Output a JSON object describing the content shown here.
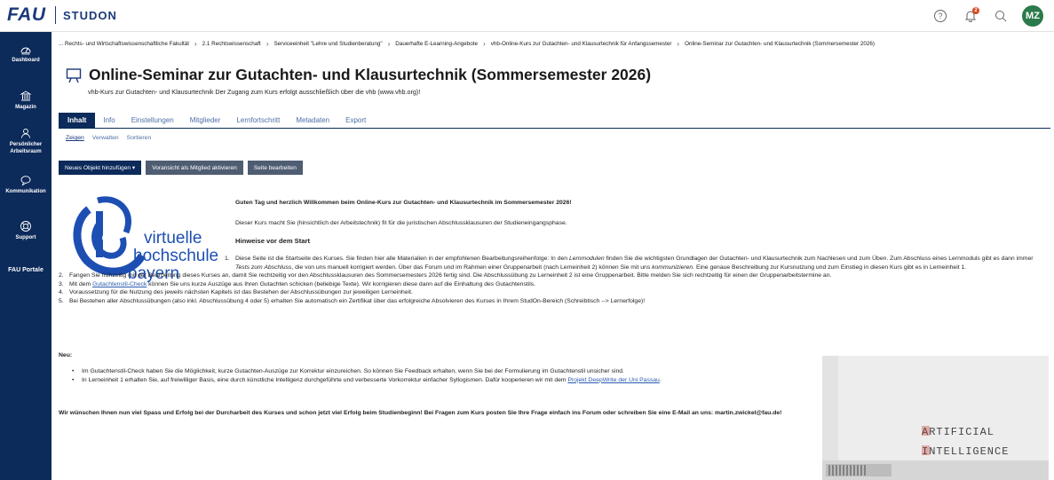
{
  "header": {
    "fau_logo": "FAU",
    "studon_logo": "STUDON",
    "help_icon": "help-circle-icon",
    "notifications_icon": "bell-icon",
    "notifications_count": "2",
    "search_icon": "search-icon",
    "avatar_initials": "MZ"
  },
  "sidebar": {
    "items": [
      {
        "label": "Dashboard",
        "icon": "dashboard-icon"
      },
      {
        "label": "Magazin",
        "icon": "library-icon"
      },
      {
        "label": "Persönlicher Arbeitsraum",
        "icon": "person-icon"
      },
      {
        "label": "Kommunikation",
        "icon": "chat-icon"
      },
      {
        "label": "Support",
        "icon": "lifebuoy-icon"
      },
      {
        "label": "FAU Portale",
        "icon": ""
      }
    ]
  },
  "breadcrumb": [
    "... Rechts- und Wirtschaftswissenschaftliche Fakultät",
    "2.1 Rechtswissenschaft",
    "Serviceeinheit \"Lehre und Studienberatung\"",
    "Dauerhafte E-Learning-Angebote",
    "vhb-Online-Kurs zur Gutachten- und Klausurtechnik für Anfangssemester",
    "Online-Seminar zur Gutachten- und Klausurtechnik (Sommersemester 2026)"
  ],
  "page": {
    "title": "Online-Seminar zur Gutachten- und Klausurtechnik (Sommersemester 2026)",
    "subtitle": "vhb-Kurs zur Gutachten- und Klausurtechnik Der Zugang zum Kurs erfolgt ausschließlich über die vhb (www.vhb.org)!"
  },
  "tabs": [
    "Inhalt",
    "Info",
    "Einstellungen",
    "Mitglieder",
    "Lernfortschritt",
    "Metadaten",
    "Export"
  ],
  "subtabs": [
    "Zeigen",
    "Verwalten",
    "Sortieren"
  ],
  "buttons": {
    "add_object": "Neues Objekt hinzufügen ▾",
    "preview_member": "Voransicht als Mitglied aktivieren",
    "edit_page": "Seite bearbeiten"
  },
  "vhb_logo": {
    "line1": "virtuelle",
    "line2": "hochschule",
    "line3": "bayern"
  },
  "content": {
    "welcome": "Guten Tag und herzlich Willkommen beim Online-Kurs zur Gutachten- und Klausurtechnik im Sommersemester 2026!",
    "intro": "Dieser Kurs macht Sie (hinsichtlich der Arbeitstechnik) fit für die juristischen Abschlussklausuren der Studieneingangsphase.",
    "hints_heading": "Hinweise vor dem Start",
    "item1_a": "Diese Seite ist die Startseite des Kurses. Sie finden hier alle Materialien in der empfohlenen Bearbeitungsreihenfolge: In den ",
    "item1_em1": "Lernmodulen",
    "item1_b": " finden Sie die wichtigsten Grundlagen der Gutachten- und Klausurtechnik zum Nachlesen und zum Üben. Zum Abschluss eines Lernmoduls gibt es dann immer ",
    "item1_em2": "Tests zum Abschluss",
    "item1_c": ", die von uns manuell korrigiert werden. Über das Forum und im Rahmen einer Gruppenarbeit (nach Lerneinheit 2) können Sie mit uns ",
    "item1_em3": "kommunizieren.",
    "item1_d": " Eine genaue Beschreibung zur Kursnutzung und zum Einstieg in diesen Kurs gibt es in Lerneinheit 1.",
    "item2": "Fangen Sie frühzeitig mit der Bearbeitung dieses Kurses an, damit Sie rechtzeitig vor den Abschlussklausuren des Sommersemesters 2026 fertig sind. Die Abschlussübung zu Lerneinheit 2 ist eine Gruppenarbeit. Bitte melden Sie sich rechtzeitig für einen der Gruppenarbeitstermine an.",
    "item3_a": "Mit dem ",
    "item3_link": "Gutachtenstil-Check",
    "item3_b": " können Sie uns kurze Auszüge aus Ihren Gutachten schicken (beliebige Texte). Wir korrigieren diese dann auf die Einhaltung des Gutachtenstils.",
    "item4": "Voraussetzung für die Nutzung des jeweils nächsten Kapitels ist das Bestehen der Abschlussübungen zur jeweiligen Lerneinheit.",
    "item5": "Bei Bestehen aller Abschlussübungen (also inkl. Abschlussübung 4 oder 5) erhalten Sie automatisch ein Zertifikat über das erfolgreiche Absolvieren des Kurses in Ihrem StudOn-Bereich (Schreibtisch --> Lernerfolge)!",
    "neu_heading": "Neu:",
    "neu1": "Im Gutachtenstil-Check haben Sie die Möglichkeit, kurze Gutachten-Auszüge zur Korrektur einzureichen. So können Sie Feedback erhalten, wenn Sie bei der Formulierung im Gutachtenstil unsicher sind.",
    "neu2_a": "In Lerneinheit 1 erhalten Sie, auf freiwilliger Basis, eine durch künstliche Intelligenz durchgeführte und verbesserte Vorkorrektur einfacher Syllogismen. Dafür kooperieren wir mit dem ",
    "neu2_link": "Projekt DeepWrite der Uni Passau",
    "neu2_b": ".",
    "closing": "Wir wünschen Ihnen nun viel Spass und Erfolg bei der Durcharbeit des Kurses und schon jetzt viel Erfolg beim Studienbeginn! Bei Fragen zum Kurs posten Sie Ihre Frage einfach ins Forum oder schreiben Sie eine E-Mail an uns: martin.zwickel@fau.de!"
  },
  "ai_image": {
    "line1": "ARTIFICIAL",
    "line2": "INTELLIGENCE"
  },
  "colors": {
    "primary": "#0c2a5a",
    "link": "#4d6fa6",
    "vhb_blue": "#1d4fb3",
    "accent_red": "#c0392b"
  }
}
